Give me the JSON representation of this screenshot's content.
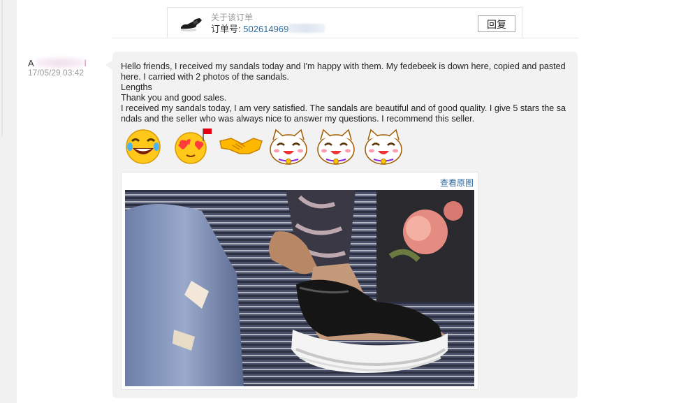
{
  "order": {
    "about_label": "关于该订单",
    "number_label": "订单号:",
    "number_value": "502614969",
    "reply_label": "回复"
  },
  "user": {
    "name_prefix": "A",
    "name_suffix": "l",
    "timestamp": "17/05/29 03:42"
  },
  "message": {
    "text": "Hello friends, I received my sandals today and I'm happy with them. My fedebeek is down here, copied and pasted here. I carried with 2 photos of the sandals.\nLengths\nThank you and good sales.\nI received my sandals today, I am very satisfied. The sandals are beautiful and of good quality. I give 5 stars the sandals and the seller who was always nice to answer my questions. I recommend this seller."
  },
  "emojis": [
    "laughing-face-icon",
    "heart-eyes-face-icon",
    "handshake-icon",
    "lucky-cat-icon",
    "lucky-cat-icon",
    "lucky-cat-icon"
  ],
  "photo": {
    "view_original_label": "查看原图",
    "subject": "sandal-photo"
  },
  "colors": {
    "link": "#2d6aa6",
    "bubble_bg": "#f2f2f2",
    "muted_text": "#999999"
  }
}
